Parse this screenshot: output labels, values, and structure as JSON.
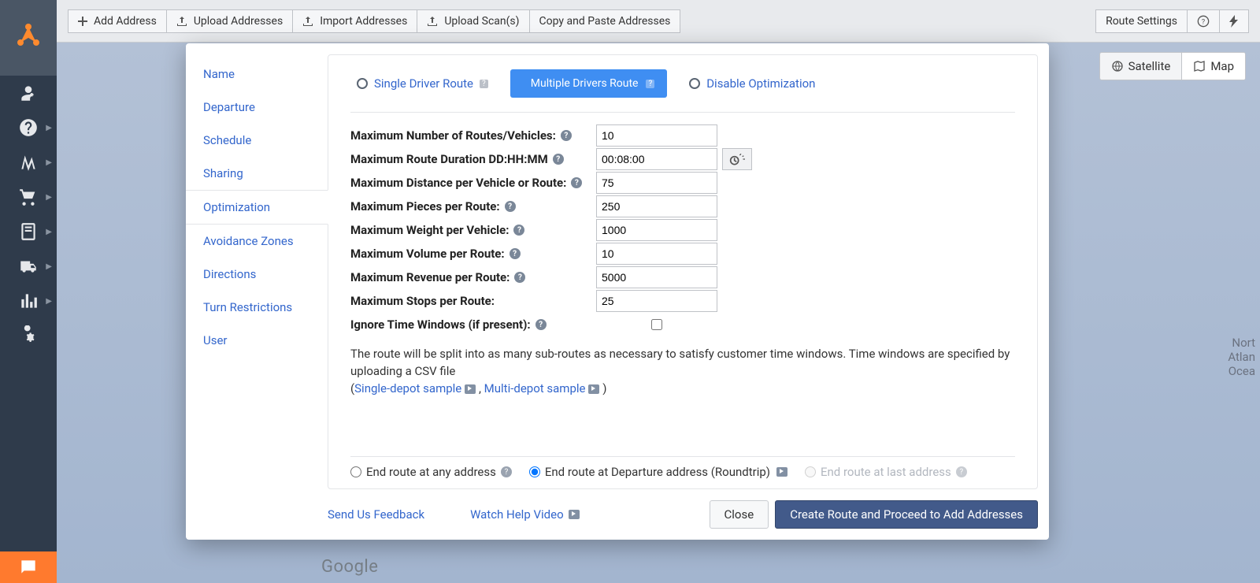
{
  "toolbar": {
    "add_address": "Add Address",
    "upload_addresses": "Upload Addresses",
    "import_addresses": "Import Addresses",
    "upload_scans": "Upload Scan(s)",
    "copy_paste": "Copy and Paste Addresses",
    "route_settings": "Route Settings"
  },
  "map_toggle": {
    "satellite": "Satellite",
    "map": "Map"
  },
  "map_labels": {
    "footer": "Google",
    "ocean": "Nort\nAtlan\nOcea"
  },
  "side_tabs": {
    "name": "Name",
    "departure": "Departure",
    "schedule": "Schedule",
    "sharing": "Sharing",
    "optimization": "Optimization",
    "avoidance": "Avoidance Zones",
    "directions": "Directions",
    "turn": "Turn Restrictions",
    "user": "User"
  },
  "route_type": {
    "single": "Single Driver Route",
    "multiple": "Multiple Drivers Route",
    "disable": "Disable Optimization"
  },
  "fields": {
    "max_routes_label": "Maximum Number of Routes/Vehicles:",
    "max_routes_value": "10",
    "max_duration_label": "Maximum Route Duration DD:HH:MM",
    "max_duration_value": "00:08:00",
    "max_distance_label": "Maximum Distance per Vehicle or Route:",
    "max_distance_value": "75",
    "max_pieces_label": "Maximum Pieces per Route:",
    "max_pieces_value": "250",
    "max_weight_label": "Maximum Weight per Vehicle:",
    "max_weight_value": "1000",
    "max_volume_label": "Maximum Volume per Route:",
    "max_volume_value": "10",
    "max_revenue_label": "Maximum Revenue per Route:",
    "max_revenue_value": "5000",
    "max_stops_label": "Maximum Stops per Route:",
    "max_stops_value": "25",
    "ignore_tw_label": "Ignore Time Windows (if present):"
  },
  "note": {
    "text_a": "The route will be split into as many sub-routes as necessary to satisfy customer time windows. Time windows are specified by uploading a CSV file",
    "text_b": "(",
    "link1": "Single-depot sample",
    "sep": " , ",
    "link2": "Multi-depot sample",
    "text_c": " )"
  },
  "end_opts": {
    "any": "End route at any address",
    "roundtrip": "End route at Departure address (Roundtrip)",
    "last": "End route at last address"
  },
  "footer": {
    "feedback": "Send Us Feedback",
    "watch": "Watch Help Video",
    "close": "Close",
    "create": "Create Route and Proceed to Add Addresses"
  }
}
